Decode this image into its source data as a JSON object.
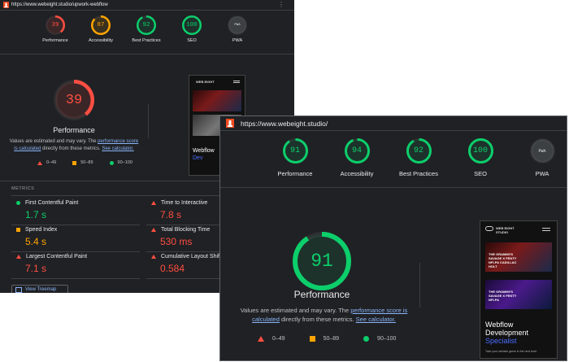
{
  "colors": {
    "fail": "#ff4e42",
    "average": "#ffa400",
    "pass": "#0cce6b",
    "link": "#8ab4f8",
    "na": "#9aa0a6"
  },
  "back": {
    "url": "https://www.webeight.studio/upwork-webflow",
    "menu_icon": "⋮",
    "gauges": [
      {
        "label": "Performance",
        "score": "39",
        "value": 39,
        "status": "fail"
      },
      {
        "label": "Accessibility",
        "score": "87",
        "value": 87,
        "status": "average"
      },
      {
        "label": "Best Practices",
        "score": "92",
        "value": 92,
        "status": "pass"
      },
      {
        "label": "SEO",
        "score": "100",
        "value": 100,
        "status": "pass"
      },
      {
        "label": "PWA",
        "score": "PWA",
        "value": 0,
        "status": "na"
      }
    ],
    "main_score": "39",
    "main_value": 39,
    "main_title": "Performance",
    "desc_prefix": "Values are estimated and may vary. The ",
    "desc_link1": "performance score is calculated",
    "desc_mid": " directly from these metrics. ",
    "desc_link2": "See calculator.",
    "legend": {
      "fail": "0–49",
      "average": "50–89",
      "pass": "90–100"
    },
    "metrics_heading": "METRICS",
    "metrics": [
      {
        "name": "First Contentful Paint",
        "value": "1.7 s",
        "status": "pass"
      },
      {
        "name": "Time to Interactive",
        "value": "7.8 s",
        "status": "fail"
      },
      {
        "name": "Speed Index",
        "value": "5.4 s",
        "status": "average"
      },
      {
        "name": "Total Blocking Time",
        "value": "530 ms",
        "status": "fail"
      },
      {
        "name": "Largest Contentful Paint",
        "value": "7.1 s",
        "status": "fail"
      },
      {
        "name": "Cumulative Layout Shift",
        "value": "0.584",
        "status": "fail"
      }
    ],
    "treemap_label": "View Treemap",
    "preview": {
      "brand": "WEB EIGHT",
      "line1": "Webflow",
      "line2": "Dev"
    }
  },
  "front": {
    "url": "https://www.webeight.studio/",
    "gauges": [
      {
        "label": "Performance",
        "score": "91",
        "value": 91,
        "status": "pass"
      },
      {
        "label": "Accessibility",
        "score": "94",
        "value": 94,
        "status": "pass"
      },
      {
        "label": "Best Practices",
        "score": "92",
        "value": 92,
        "status": "pass"
      },
      {
        "label": "SEO",
        "score": "100",
        "value": 100,
        "status": "pass"
      },
      {
        "label": "PWA",
        "score": "PWA",
        "value": 0,
        "status": "na"
      }
    ],
    "main_score": "91",
    "main_value": 91,
    "main_title": "Performance",
    "desc_prefix": "Values are estimated and may vary. The ",
    "desc_link1": "performance score is calculated",
    "desc_mid": " directly from these metrics. ",
    "desc_link2": "See calculator.",
    "legend": {
      "fail": "0–49",
      "average": "50–89",
      "pass": "90–100"
    },
    "preview": {
      "brand": "WEB EIGHT STUDIO",
      "hero1_text": "THE GRAMMYS SAVAGE X FENTY NFLPA CADILLAC HOLT",
      "hero2_text": "THE GRAMMYS SAVAGE X FENTY NFLPA",
      "line1": "Webflow",
      "line2": "Development",
      "line3": "Specialist",
      "footer": "Take your website game to the next level"
    }
  }
}
